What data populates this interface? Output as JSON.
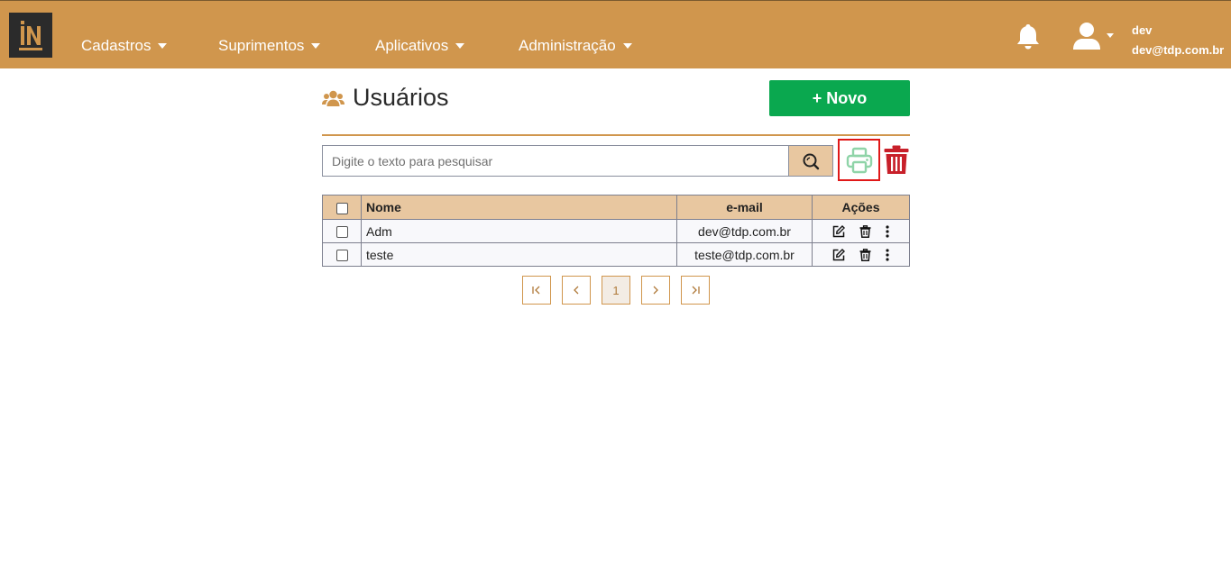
{
  "nav": {
    "logo_text": "IN",
    "items": [
      {
        "label": "Cadastros"
      },
      {
        "label": "Suprimentos"
      },
      {
        "label": "Aplicativos"
      },
      {
        "label": "Administração"
      }
    ],
    "user": {
      "name": "dev",
      "email": "dev@tdp.com.br"
    }
  },
  "page": {
    "title": "Usuários",
    "new_button": "+ Novo",
    "search_placeholder": "Digite o texto para pesquisar"
  },
  "table": {
    "headers": {
      "name": "Nome",
      "email": "e-mail",
      "actions": "Ações"
    },
    "rows": [
      {
        "name": "Adm",
        "email": "dev@tdp.com.br"
      },
      {
        "name": "teste",
        "email": "teste@tdp.com.br"
      }
    ]
  },
  "pagination": {
    "first": "|<",
    "prev": "<",
    "current": "1",
    "next": ">",
    "last": ">|"
  },
  "colors": {
    "brand": "#d0964d",
    "header_fill": "#e8c7a0",
    "new_button": "#0aa84f",
    "delete": "#c8202a",
    "print": "#8fd4a8",
    "highlight": "#e01818"
  }
}
